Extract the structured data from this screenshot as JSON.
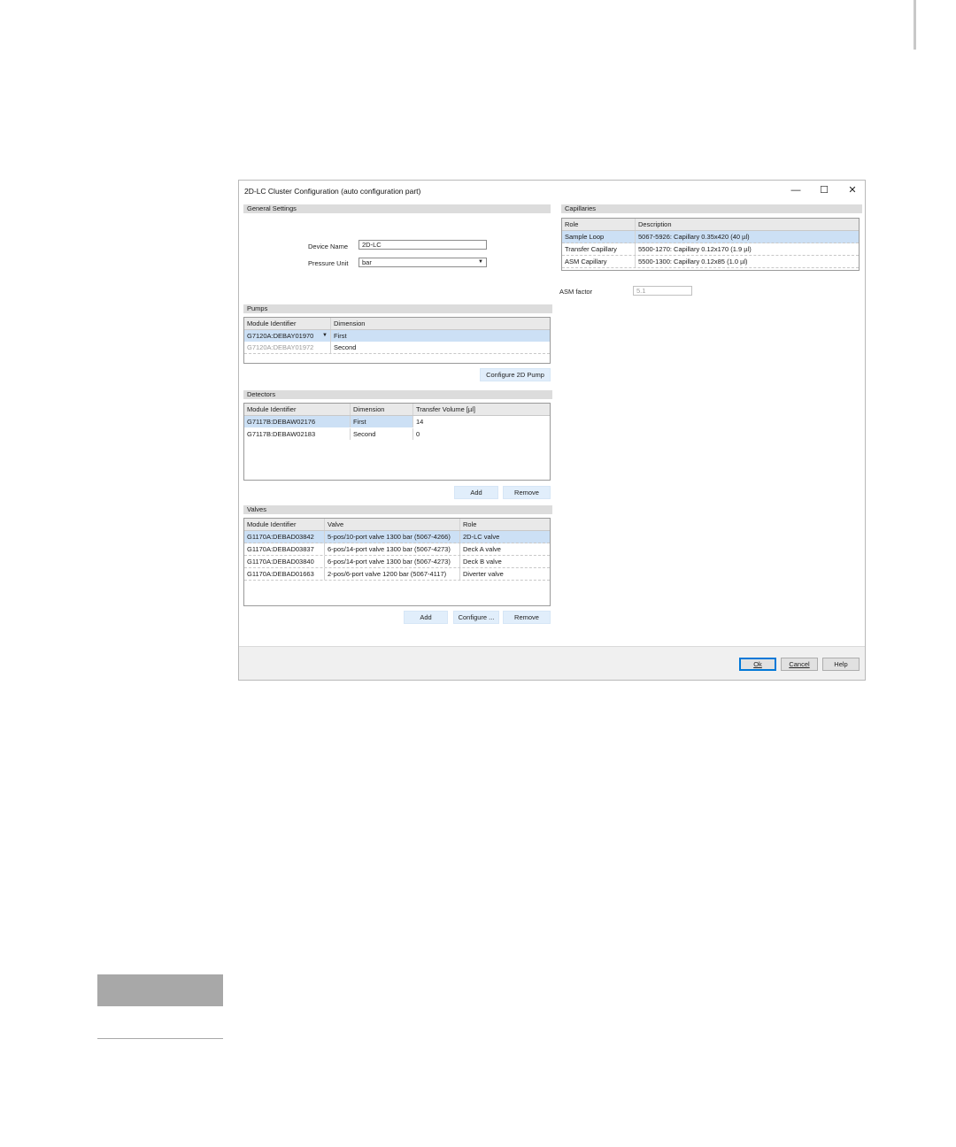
{
  "window": {
    "title": "2D-LC Cluster Configuration (auto configuration part)",
    "minimize": "—",
    "maximize": "☐",
    "close": "✕"
  },
  "general": {
    "header": "General Settings",
    "device_name_label": "Device Name",
    "device_name_value": "2D-LC",
    "pressure_unit_label": "Pressure Unit",
    "pressure_unit_value": "bar"
  },
  "pumps": {
    "header": "Pumps",
    "columns": [
      "Module Identifier",
      "Dimension"
    ],
    "rows": [
      {
        "module": "G7120A:DEBAY01970",
        "dimension": "First"
      },
      {
        "module": "G7120A:DEBAY01972",
        "dimension": "Second"
      }
    ],
    "configure_button": "Configure 2D Pump"
  },
  "detectors": {
    "header": "Detectors",
    "columns": [
      "Module Identifier",
      "Dimension",
      "Transfer Volume [µl]"
    ],
    "rows": [
      {
        "module": "G7117B:DEBAW02176",
        "dimension": "First",
        "volume": "14"
      },
      {
        "module": "G7117B:DEBAW02183",
        "dimension": "Second",
        "volume": "0"
      }
    ],
    "add_button": "Add",
    "remove_button": "Remove"
  },
  "valves": {
    "header": "Valves",
    "columns": [
      "Module Identifier",
      "Valve",
      "Role"
    ],
    "rows": [
      {
        "module": "G1170A:DEBAD03842",
        "valve": "5-pos/10-port valve 1300 bar (5067-4266)",
        "role": "2D-LC valve"
      },
      {
        "module": "G1170A:DEBAD03837",
        "valve": "6-pos/14-port valve 1300 bar (5067-4273)",
        "role": "Deck A valve"
      },
      {
        "module": "G1170A:DEBAD03840",
        "valve": "6-pos/14-port valve 1300 bar (5067-4273)",
        "role": "Deck B valve"
      },
      {
        "module": "G1170A:DEBAD01663",
        "valve": "2-pos/6-port valve 1200 bar (5067-4117)",
        "role": "Diverter valve"
      }
    ],
    "add_button": "Add",
    "configure_button": "Configure ...",
    "remove_button": "Remove"
  },
  "capillaries": {
    "header": "Capillaries",
    "columns": [
      "Role",
      "Description"
    ],
    "rows": [
      {
        "role": "Sample Loop",
        "description": "5067-5926: Capillary 0.35x420 (40 µl)"
      },
      {
        "role": "Transfer Capillary",
        "description": "5500-1270: Capillary 0.12x170 (1.9 µl)"
      },
      {
        "role": "ASM Capillary",
        "description": "5500-1300: Capillary 0.12x85 (1.0 µl)"
      }
    ],
    "asm_label": "ASM factor",
    "asm_value": "5.1"
  },
  "footer": {
    "ok": "Ok",
    "cancel": "Cancel",
    "help": "Help"
  }
}
